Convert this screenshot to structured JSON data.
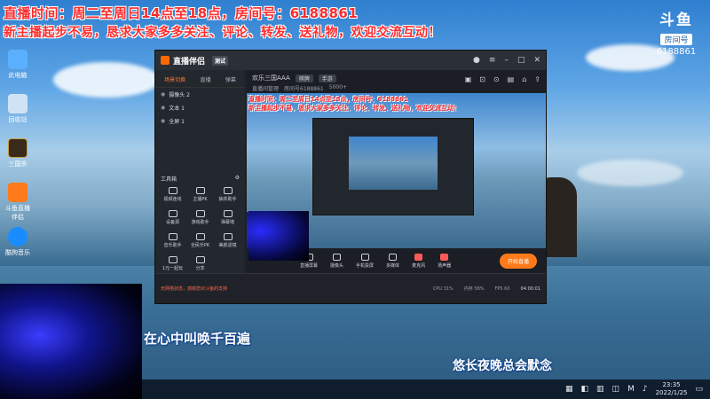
{
  "overlay": {
    "line1": "直播时间：周二至周日14点至18点，房间号：6188861",
    "line2": "新主播起步不易，恳求大家多多关注、评论、转发、送礼物，欢迎交流互动！"
  },
  "logo": {
    "mark": "斗鱼",
    "sub": "房间号",
    "room": "6188861"
  },
  "desktop_icons": [
    {
      "label": "此电脑"
    },
    {
      "label": "回收站"
    },
    {
      "label": "三国杀"
    },
    {
      "label": "斗鱼直播伴侣"
    },
    {
      "label": "酷狗音乐"
    }
  ],
  "app": {
    "title": "直播伴侣",
    "version": "测试",
    "left_tabs": [
      "场景切换",
      "直播",
      "弹幕"
    ],
    "scenes": [
      {
        "label": "摄像头 2"
      },
      {
        "label": "文本 1"
      },
      {
        "label": "全屏 1"
      }
    ],
    "tools_title": "工具箱",
    "tools": [
      {
        "label": "视频连线"
      },
      {
        "label": "主播PK"
      },
      {
        "label": "抽奖助手"
      },
      {
        "label": "设备源"
      },
      {
        "label": "游戏助手"
      },
      {
        "label": "弹幕墙"
      },
      {
        "label": "音乐助手"
      },
      {
        "label": "全民乐PK"
      },
      {
        "label": "美颜滤镜"
      },
      {
        "label": "1元一起玩"
      },
      {
        "label": "分享"
      }
    ],
    "header": {
      "room_title": "欢乐三国AAA",
      "category": "棋牌",
      "mode": "手游",
      "sub1": "直播间管理",
      "sub2": "房间号6188861",
      "sub3": "5000+"
    },
    "preview_lines": [
      "直播时间：周二至周日14点至18点，房间号：6188861",
      "新主播起步不易，恳求大家多多关注、评论、转发、送礼物，欢迎交流互动！"
    ],
    "bottom_tools": [
      {
        "label": "直播屏幕"
      },
      {
        "label": "摄像头"
      },
      {
        "label": "手机投屏"
      },
      {
        "label": "多媒体"
      },
      {
        "label": "麦克风"
      },
      {
        "label": "扬声器"
      }
    ],
    "start_button": "开始直播",
    "status_notice": "无网络状态，感谢您对斗鱼的支持",
    "status_items": [
      "CPU 31%",
      "内存 58%",
      "FPS 60"
    ],
    "status_time": "04:00:01",
    "colors": {
      "accent": "#ff7a1a",
      "overlay_red": "#ff2b2b"
    }
  },
  "lyrics": {
    "line1": "在心中叫唤千百遍",
    "line2": "悠长夜晚总会默念"
  },
  "taskbar": {
    "time": "23:35",
    "date": "2022/1/25"
  }
}
